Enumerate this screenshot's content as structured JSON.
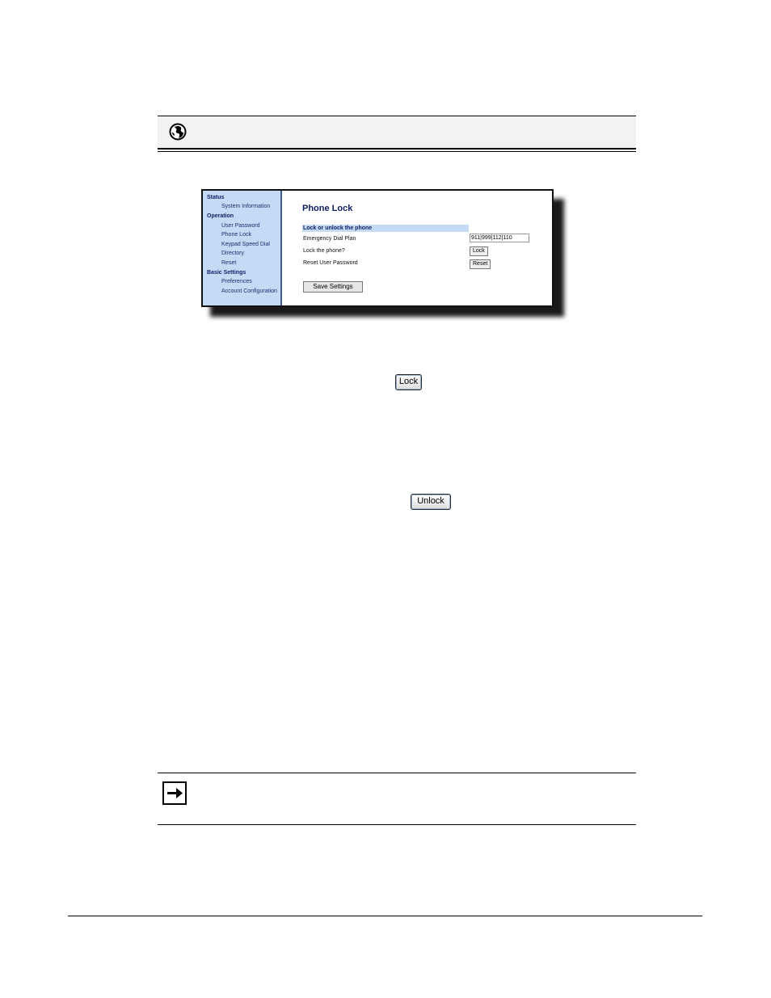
{
  "sidebar": {
    "status": "Status",
    "system_information": "System Information",
    "operation": "Operation",
    "user_password": "User Password",
    "phone_lock": "Phone Lock",
    "keypad_speed_dial": "Keypad Speed Dial",
    "directory": "Directory",
    "reset": "Reset",
    "basic_settings": "Basic Settings",
    "preferences": "Preferences",
    "account_configuration": "Account Configuration"
  },
  "main": {
    "title": "Phone Lock",
    "section": "Lock or unlock the phone",
    "emergency_label": "Emergency Dial Plan",
    "emergency_value": "911|999|112|110",
    "lock_label": "Lock the phone?",
    "lock_button": "Lock",
    "reset_label": "Reset User Password",
    "reset_button": "Reset",
    "save_button": "Save Settings"
  },
  "body": {
    "lock_button": "Lock",
    "unlock_button": "Unlock"
  },
  "icons": {
    "header": "globe-icon",
    "note": "arrow-right-icon"
  },
  "colors": {
    "sidebar_bg": "#c5daf5",
    "title_text": "#0b1f63"
  }
}
